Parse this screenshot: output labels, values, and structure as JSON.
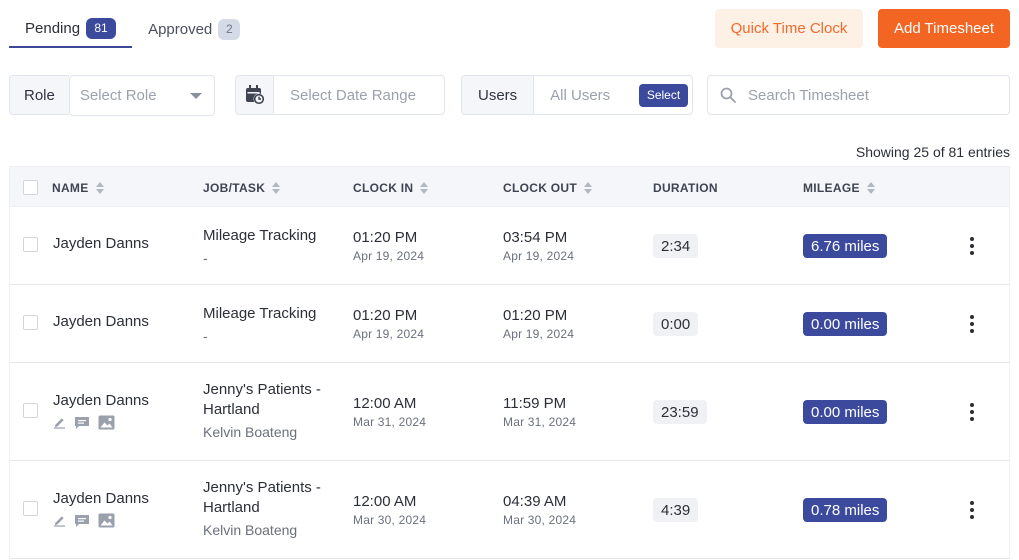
{
  "tabs": [
    {
      "label": "Pending",
      "count": "81"
    },
    {
      "label": "Approved",
      "count": "2"
    }
  ],
  "actions": {
    "quick_time_clock": "Quick Time Clock",
    "add_timesheet": "Add Timesheet"
  },
  "filters": {
    "role_label": "Role",
    "role_placeholder": "Select Role",
    "date_placeholder": "Select Date Range",
    "users_label": "Users",
    "users_value": "All Users",
    "users_select": "Select",
    "search_placeholder": "Search Timesheet"
  },
  "showing": "Showing 25 of 81 entries",
  "columns": {
    "name": "NAME",
    "job_task": "JOB/TASK",
    "clock_in": "CLOCK IN",
    "clock_out": "CLOCK OUT",
    "duration": "DURATION",
    "mileage": "MILEAGE"
  },
  "rows": [
    {
      "name": "Jayden Danns",
      "task_line1": "Mileage Tracking",
      "task_line2": "",
      "sub": "-",
      "in_time": "01:20 PM",
      "in_date": "Apr 19, 2024",
      "out_time": "03:54 PM",
      "out_date": "Apr 19, 2024",
      "duration": "2:34",
      "mileage": "6.76 miles"
    },
    {
      "name": "Jayden Danns",
      "task_line1": "Mileage Tracking",
      "task_line2": "",
      "sub": "-",
      "in_time": "01:20 PM",
      "in_date": "Apr 19, 2024",
      "out_time": "01:20 PM",
      "out_date": "Apr 19, 2024",
      "duration": "0:00",
      "mileage": "0.00 miles"
    },
    {
      "name": "Jayden Danns",
      "task_line1": "Jenny's Patients -",
      "task_line2": "Hartland",
      "sub": "Kelvin Boateng",
      "in_time": "12:00 AM",
      "in_date": "Mar 31, 2024",
      "out_time": "11:59 PM",
      "out_date": "Mar 31, 2024",
      "duration": "23:59",
      "mileage": "0.00 miles"
    },
    {
      "name": "Jayden Danns",
      "task_line1": "Jenny's Patients -",
      "task_line2": "Hartland",
      "sub": "Kelvin Boateng",
      "in_time": "12:00 AM",
      "in_date": "Mar 30, 2024",
      "out_time": "04:39 AM",
      "out_date": "Mar 30, 2024",
      "duration": "4:39",
      "mileage": "0.78 miles"
    }
  ]
}
